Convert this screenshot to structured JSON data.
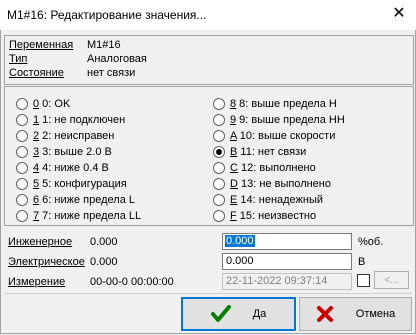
{
  "window": {
    "title": "M1#16: Редактирование значения..."
  },
  "info": [
    {
      "label": "Переменная",
      "value": "M1#16"
    },
    {
      "label": "Тип",
      "value": "Аналоговая"
    },
    {
      "label": "Состояние",
      "value": "нет связи"
    }
  ],
  "states": {
    "left": [
      {
        "key": "0",
        "rest": " 0: OK"
      },
      {
        "key": "1",
        "rest": " 1: не подключен"
      },
      {
        "key": "2",
        "rest": " 2: неисправен"
      },
      {
        "key": "3",
        "rest": " 3: выше 2.0 В"
      },
      {
        "key": "4",
        "rest": " 4: ниже 0.4 В"
      },
      {
        "key": "5",
        "rest": " 5: конфигурация"
      },
      {
        "key": "6",
        "rest": " 6: ниже предела L"
      },
      {
        "key": "7",
        "rest": " 7: ниже предела LL"
      }
    ],
    "right": [
      {
        "key": "8",
        "rest": " 8: выше предела H"
      },
      {
        "key": "9",
        "rest": " 9: выше предела HH"
      },
      {
        "key": "A",
        "rest": " 10: выше скорости"
      },
      {
        "key": "B",
        "rest": " 11: нет связи"
      },
      {
        "key": "C",
        "rest": " 12: выполнено"
      },
      {
        "key": "D",
        "rest": " 13: не выполнено"
      },
      {
        "key": "E",
        "rest": " 14: ненадежный"
      },
      {
        "key": "F",
        "rest": " 15: неизвестно"
      }
    ],
    "selected": "B"
  },
  "engineering": {
    "label": "Инженерное",
    "value": "0.000",
    "input": "0.000",
    "unit": "%об."
  },
  "electrical": {
    "label": "Электрическое",
    "value": "0.000",
    "input": "0.000",
    "unit": "В"
  },
  "measurement": {
    "label": "Измерение",
    "value": "00-00-0 00:00:00",
    "input": "22-11-2022 09:37:14",
    "button": "<..."
  },
  "buttons": {
    "ok": "Да",
    "cancel": "Отмена"
  },
  "colors": {
    "selection": "#0078d7",
    "ok_check": "#008000",
    "cancel_x": "#cc0000"
  }
}
